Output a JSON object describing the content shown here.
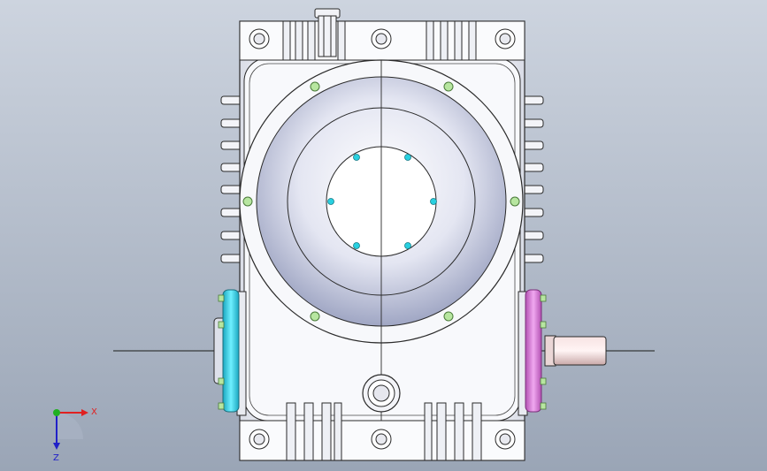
{
  "viewport": {
    "background_top": "#cdd4df",
    "background_bottom": "#9aa5b6"
  },
  "colors": {
    "outline": "#2a2a2a",
    "housing": "#f6f7fa",
    "dial_center": "#ffffff",
    "dial_edge": "#9aa1c0",
    "bolt_green": "#b7e6a0",
    "bolt_cyan": "#28d0e0",
    "flange_cyan": "#35d7e6",
    "flange_magenta": "#d87ad8",
    "shaft": "#f3dada",
    "axis_x": "#e02020",
    "axis_y": "#20b020",
    "axis_z": "#2020c8"
  },
  "triad": {
    "x_label": "X",
    "z_label": "Z",
    "icon": "coordinate-triad-icon"
  }
}
